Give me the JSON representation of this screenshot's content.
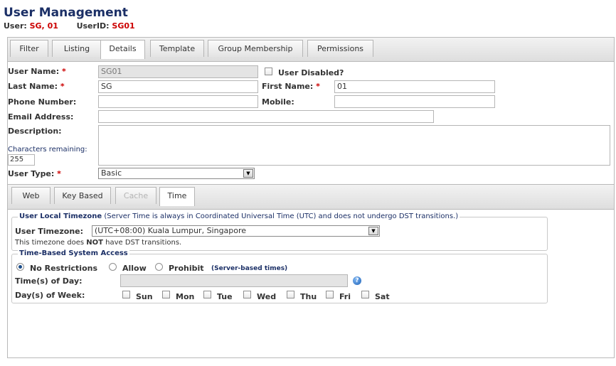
{
  "page": {
    "title": "User Management"
  },
  "header": {
    "user_label": "User:",
    "user_value": "SG, 01",
    "userid_label": "UserID:",
    "userid_value": "SG01"
  },
  "tabs": [
    {
      "label": "Filter"
    },
    {
      "label": "Listing"
    },
    {
      "label": "Details",
      "active": true
    },
    {
      "label": "Template"
    },
    {
      "label": "Group Membership"
    },
    {
      "label": "Permissions"
    }
  ],
  "form": {
    "required_mark": "*",
    "user_name": {
      "label": "User Name:",
      "value": "SG01"
    },
    "user_disabled": {
      "label": "User Disabled?",
      "checked": false
    },
    "last_name": {
      "label": "Last Name:",
      "value": "SG"
    },
    "first_name": {
      "label": "First Name:",
      "value": "01"
    },
    "phone": {
      "label": "Phone Number:",
      "value": ""
    },
    "mobile": {
      "label": "Mobile:",
      "value": ""
    },
    "email": {
      "label": "Email Address:",
      "value": ""
    },
    "description": {
      "label": "Description:",
      "value": ""
    },
    "chars_remaining": {
      "label": "Characters remaining:",
      "value": "255"
    },
    "user_type": {
      "label": "User Type:",
      "value": "Basic"
    }
  },
  "subtabs": [
    {
      "label": "Web"
    },
    {
      "label": "Key Based"
    },
    {
      "label": "Cache",
      "disabled": true
    },
    {
      "label": "Time",
      "active": true
    }
  ],
  "timezone": {
    "legend_title": "User Local Timezone",
    "legend_note": " (Server Time is always in Coordinated Universal Time (UTC) and does not undergo DST transitions.)",
    "label": "User Timezone:",
    "value": "(UTC+08:00) Kuala Lumpur, Singapore",
    "dst_pre": "This timezone does ",
    "dst_not": "NOT",
    "dst_post": " have DST transitions."
  },
  "access": {
    "legend_title": "Time-Based System Access",
    "options": [
      {
        "label": "No Restrictions",
        "selected": true
      },
      {
        "label": "Allow",
        "selected": false
      },
      {
        "label": "Prohibit",
        "selected": false
      }
    ],
    "server_note": "(Server-based times)",
    "times_label": "Time(s) of Day:",
    "times_value": "",
    "days_label": "Day(s) of Week:",
    "days": [
      "Sun",
      "Mon",
      "Tue",
      "Wed",
      "Thu",
      "Fri",
      "Sat"
    ]
  },
  "icons": {
    "help": "help-icon",
    "dropdown": "chevron-down-icon"
  },
  "colors": {
    "title": "#1b2f66",
    "required": "#cc0000",
    "accent": "#1a4d8a"
  }
}
